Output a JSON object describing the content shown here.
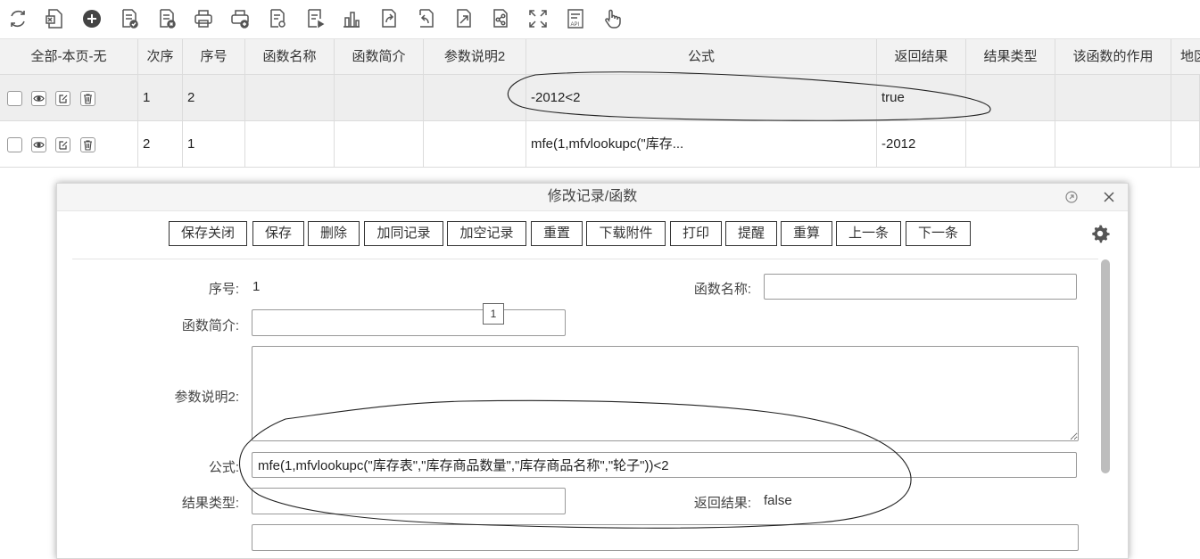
{
  "toolbar": {
    "icons": [
      "refresh-icon",
      "excel-export-icon",
      "add-circle-icon",
      "doc-check-icon",
      "doc-delete-icon",
      "print-icon",
      "print-add-icon",
      "doc-settings-icon",
      "doc-run-icon",
      "chart-icon",
      "share-arrow-icon",
      "undo-doc-icon",
      "redo-doc-icon",
      "doc-share-icon",
      "fullscreen-icon",
      "api-icon",
      "hand-pointer-icon"
    ]
  },
  "grid": {
    "headers": [
      "全部-本页-无",
      "次序",
      "序号",
      "函数名称",
      "函数简介",
      "参数说明2",
      "公式",
      "返回结果",
      "结果类型",
      "该函数的作用",
      "地区"
    ],
    "rows": [
      {
        "order": "1",
        "seq": "2",
        "name": "",
        "intro": "",
        "param2": "",
        "formula": "-2012<2",
        "result": "true",
        "rtype": "",
        "purpose": ""
      },
      {
        "order": "2",
        "seq": "1",
        "name": "",
        "intro": "",
        "param2": "",
        "formula": "mfe(1,mfvlookupc(\"库存...",
        "result": "-2012",
        "rtype": "",
        "purpose": ""
      }
    ]
  },
  "dialog": {
    "title": "修改记录/函数",
    "buttons": [
      "保存关闭",
      "保存",
      "删除",
      "加同记录",
      "加空记录",
      "重置",
      "下载附件",
      "打印",
      "提醒",
      "重算",
      "上一条",
      "下一条"
    ],
    "fields": {
      "seq_label": "序号:",
      "seq_value": "1",
      "name_label": "函数名称:",
      "name_value": "",
      "intro_label": "函数简介:",
      "intro_value": "",
      "tooltip": "1",
      "param2_label": "参数说明2:",
      "param2_value": "",
      "formula_label": "公式:",
      "formula_value": "mfe(1,mfvlookupc(\"库存表\",\"库存商品数量\",\"库存商品名称\",\"轮子\"))<2",
      "rtype_label": "结果类型:",
      "rtype_value": "",
      "result_label": "返回结果:",
      "result_value": "false"
    }
  },
  "colors": {
    "accent": "#333333",
    "header_bg": "#f2f2f2",
    "selected_row": "#eeeeee"
  }
}
